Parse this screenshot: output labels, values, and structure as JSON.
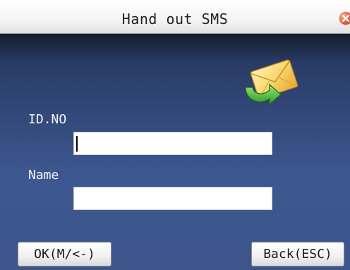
{
  "window": {
    "title": "Hand out SMS",
    "close_icon": "close-icon"
  },
  "icon": {
    "name": "sms-envelope-icon"
  },
  "form": {
    "id_label": "ID.NO",
    "id_value": "",
    "name_label": "Name",
    "name_value": ""
  },
  "footer": {
    "ok_label": "OK(M/<-)",
    "back_label": "Back(ESC)"
  },
  "colors": {
    "background_top": "#1f2c4a",
    "background_bottom": "#3d5790",
    "titlebar": "#f4f4f4",
    "envelope": "#f7d36a",
    "arrow": "#4cb83a"
  }
}
